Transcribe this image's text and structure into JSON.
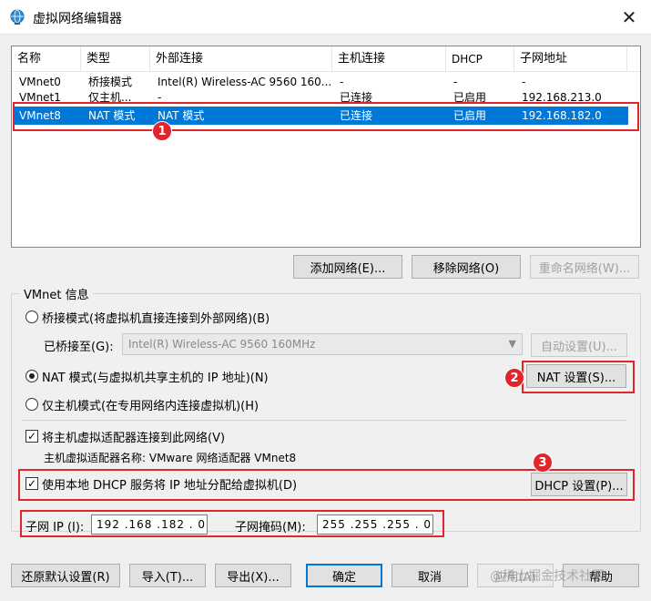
{
  "window": {
    "title": "虚拟网络编辑器",
    "close": "✕"
  },
  "table": {
    "headers": [
      "名称",
      "类型",
      "外部连接",
      "主机连接",
      "DHCP",
      "子网地址"
    ],
    "rows": [
      [
        "VMnet0",
        "桥接模式",
        "Intel(R) Wireless-AC 9560 160...",
        "-",
        "-",
        "-"
      ],
      [
        "VMnet1",
        "仅主机...",
        "-",
        "已连接",
        "已启用",
        "192.168.213.0"
      ],
      [
        "VMnet8",
        "NAT 模式",
        "NAT 模式",
        "已连接",
        "已启用",
        "192.168.182.0"
      ]
    ],
    "selected_row": 2
  },
  "list_buttons": {
    "add": "添加网络(E)...",
    "remove": "移除网络(O)",
    "rename": "重命名网络(W)..."
  },
  "info": {
    "group_label": "VMnet 信息",
    "bridge_mode": "桥接模式(将虚拟机直接连接到外部网络)(B)",
    "bridged_to_label": "已桥接至(G):",
    "bridged_to_value": "Intel(R) Wireless-AC 9560 160MHz",
    "auto_settings": "自动设置(U)...",
    "nat_mode": "NAT 模式(与虚拟机共享主机的 IP 地址)(N)",
    "nat_settings": "NAT 设置(S)...",
    "host_only": "仅主机模式(在专用网络内连接虚拟机)(H)",
    "connect_adapter": "将主机虚拟适配器连接到此网络(V)",
    "adapter_name": "主机虚拟适配器名称: VMware 网络适配器 VMnet8",
    "use_dhcp": "使用本地 DHCP 服务将 IP 地址分配给虚拟机(D)",
    "dhcp_settings": "DHCP 设置(P)...",
    "subnet_ip_label": "子网 IP (I):",
    "subnet_ip": "192 .168 .182 . 0",
    "subnet_mask_label": "子网掩码(M):",
    "subnet_mask": "255 .255 .255 . 0"
  },
  "bottom_buttons": {
    "restore": "还原默认设置(R)",
    "import": "导入(T)...",
    "export": "导出(X)...",
    "ok": "确定",
    "cancel": "取消",
    "apply": "应用(A)",
    "help": "帮助"
  },
  "annotations": {
    "badge1": "1",
    "badge2": "2",
    "badge3": "3"
  },
  "watermark": "@稀土掘金技术社区",
  "colors": {
    "selection": "#0078d7",
    "annotation_red": "#e0262c"
  }
}
